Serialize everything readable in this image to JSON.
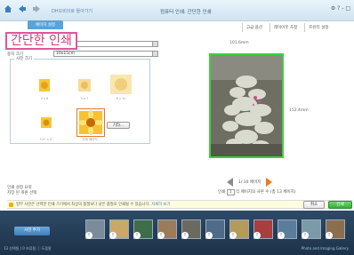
{
  "window": {
    "back_link": "DH오비의로 돌아가기",
    "title": "컴퓨터 인쇄: 간단한 인쇄",
    "ctrls": "⚙ ? - □"
  },
  "tab": {
    "label": "페이지 설정"
  },
  "toolbar": [
    "고급 옵션",
    "레이아웃 조정",
    "프린터 설정"
  ],
  "big_title": "간단한 인쇄",
  "fields": {
    "paper_label": "용지 크기",
    "paper_value": "10x15cm"
  },
  "photo_size": {
    "legend": "사진 크기",
    "thumbs": [
      {
        "label": "4 x 6"
      },
      {
        "label": "5 x 7"
      },
      {
        "label": "8 x 10"
      },
      {
        "label": "3.5\" x 5\""
      },
      {
        "label": "전체 페이지"
      }
    ],
    "more_label": "기타..."
  },
  "preview": {
    "width_text": "101.6mm",
    "height_text": "152.4mm"
  },
  "pager": {
    "text": "1/ 10 페이지"
  },
  "info": {
    "line1": "인쇄 설정 요약",
    "line2": "저장 된 개원 선택"
  },
  "count": {
    "prefix": "인쇄",
    "copies": "1",
    "suffix": "각 페이지의 사본 수 (총 13 페이지)"
  },
  "warning": {
    "text": "일부 사진은 선택한 인쇄 크기에서 최상의 품질보다 낮은 품질로 인쇄될 수 있습니다.",
    "link": "자세히 보기"
  },
  "buttons": {
    "cancel": "취소",
    "print": "인쇄"
  },
  "filmstrip": {
    "add_label": "사진 추가",
    "status": "13 선택됨 | 0 보류됨 ⓘ 도움말",
    "brand": "Photo and Imaging Gallery"
  },
  "colors": {
    "accent": "#3fd03f",
    "title": "#d23a7a"
  }
}
